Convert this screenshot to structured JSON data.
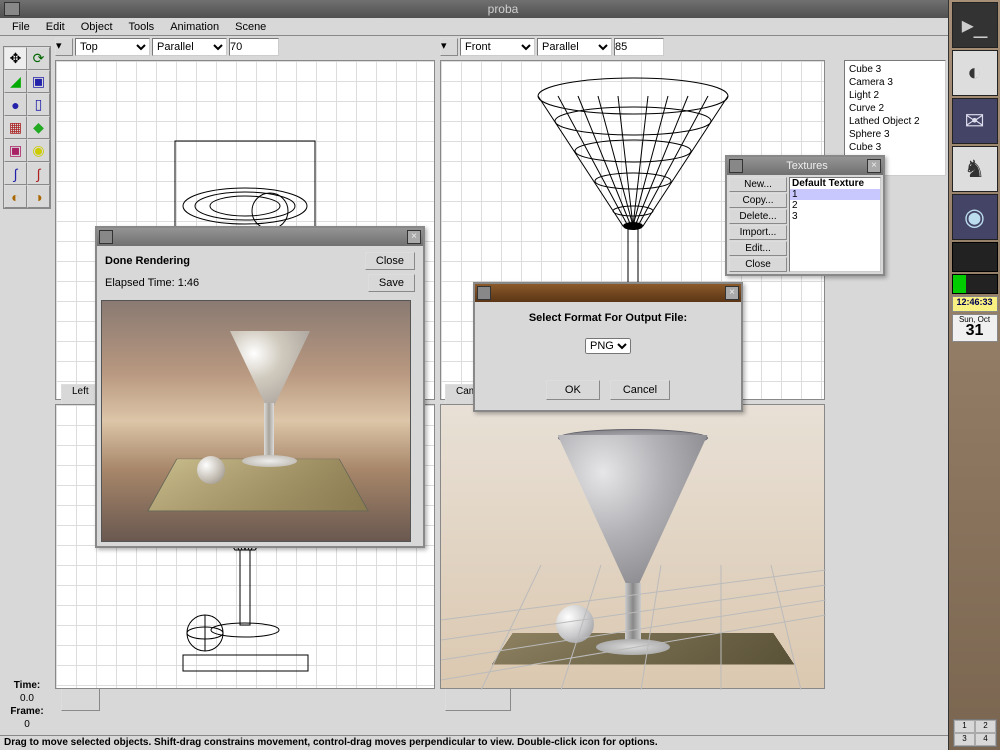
{
  "window": {
    "title": "proba"
  },
  "menubar": [
    "File",
    "Edit",
    "Object",
    "Tools",
    "Animation",
    "Scene"
  ],
  "viewports": {
    "tl": {
      "view": "Top",
      "proj": "Parallel",
      "zoom": "70",
      "label": "Left"
    },
    "tr": {
      "view": "Front",
      "proj": "Parallel",
      "zoom": "85",
      "label": "Camera 1"
    }
  },
  "scene_list": [
    "Cube 3",
    "Camera 3",
    "Light 2",
    "Curve 2",
    "Lathed Object 2",
    "Sphere 3",
    "Cube 3"
  ],
  "time_panel": {
    "time_label": "Time:",
    "time_value": "0.0",
    "frame_label": "Frame:",
    "frame_value": "0"
  },
  "statusbar": "Drag to move selected objects.  Shift-drag constrains movement, control-drag moves perpendicular to view.  Double-click icon for options.",
  "render_win": {
    "title": "Done Rendering",
    "close": "Close",
    "elapsed_label": "Elapsed Time: 1:46",
    "save": "Save"
  },
  "textures_win": {
    "title": "Textures",
    "buttons": [
      "New...",
      "Copy...",
      "Delete...",
      "Import...",
      "Edit...",
      "Close"
    ],
    "items": [
      "Default Texture",
      "1",
      "2",
      "3"
    ],
    "selected": "1"
  },
  "format_dlg": {
    "prompt": "Select Format For Output File:",
    "format": "PNG",
    "ok": "OK",
    "cancel": "Cancel"
  },
  "dock": {
    "clock": "12:46:33",
    "day": "Sun, Oct",
    "date": "31"
  }
}
